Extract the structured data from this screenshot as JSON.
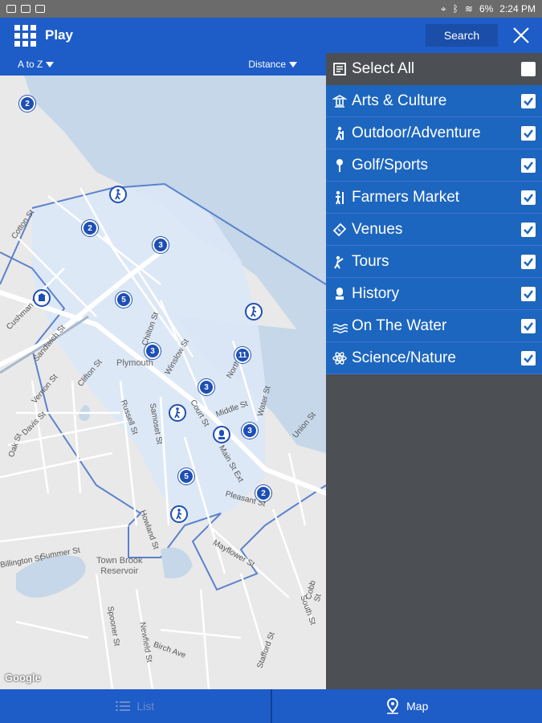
{
  "status": {
    "battery": "6%",
    "time": "2:24 PM"
  },
  "appbar": {
    "title": "Play",
    "search_label": "Search"
  },
  "sort": {
    "left": "A to Z",
    "right": "Distance"
  },
  "map": {
    "town": "Plymouth",
    "reservoir": "Town Brook\nReservoir",
    "attribution": "Google",
    "clusters": [
      "2",
      "2",
      "3",
      "5",
      "3",
      "11",
      "3",
      "3",
      "5",
      "2"
    ],
    "streets": [
      "Cotton St",
      "Cushman St",
      "Sandwich St",
      "Vernon St",
      "Clifton St",
      "Davis St",
      "Oak St",
      "Russell St",
      "Samoset St",
      "Summer St",
      "Billington St",
      "Howland St",
      "Mayflower St",
      "Pleasant St",
      "Main St Ext",
      "South St",
      "Newfield St",
      "Spooner St",
      "Union St",
      "Water St",
      "North St",
      "Middle St",
      "Court St",
      "Chilton St",
      "Winslow St",
      "Birch Ave",
      "Stafford St",
      "Cobb St"
    ]
  },
  "filters": {
    "header": {
      "label": "Select All",
      "checked": false
    },
    "items": [
      {
        "label": "Arts & Culture",
        "icon": "arts-culture-icon",
        "checked": true
      },
      {
        "label": "Outdoor/Adventure",
        "icon": "hiker-icon",
        "checked": true
      },
      {
        "label": "Golf/Sports",
        "icon": "golf-icon",
        "checked": true
      },
      {
        "label": "Farmers Market",
        "icon": "farmers-market-icon",
        "checked": true
      },
      {
        "label": "Venues",
        "icon": "ticket-icon",
        "checked": true
      },
      {
        "label": "Tours",
        "icon": "tour-guide-icon",
        "checked": true
      },
      {
        "label": "History",
        "icon": "history-icon",
        "checked": true
      },
      {
        "label": "On The Water",
        "icon": "water-icon",
        "checked": true
      },
      {
        "label": "Science/Nature",
        "icon": "atom-icon",
        "checked": true
      }
    ]
  },
  "bottom": {
    "list_label": "List",
    "map_label": "Map"
  }
}
